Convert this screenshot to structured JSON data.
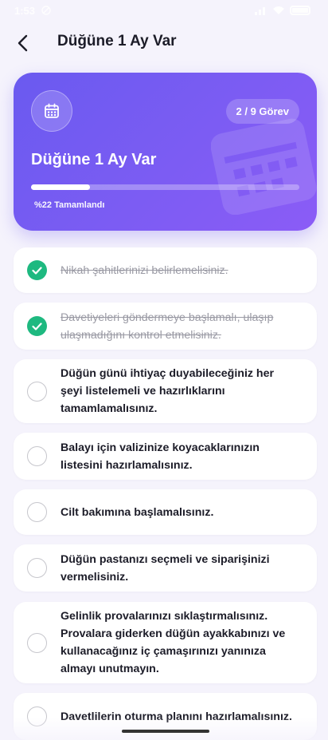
{
  "status_bar": {
    "time": "1:53"
  },
  "header": {
    "title": "Düğüne 1 Ay Var"
  },
  "hero": {
    "title": "Düğüne 1 Ay Var",
    "task_count": "2 / 9 Görev",
    "completed_text": "%22 Tamamlandı",
    "progress": 0.22,
    "gradient_start": "#6a5af0",
    "gradient_end": "#8b5cf6"
  },
  "accent_colors": {
    "done_check": "#1eb980",
    "todo_ring": "#c6c6cc"
  },
  "tasks": [
    {
      "text": "Nikah şahitlerinizi belirlemelisiniz.",
      "done": true
    },
    {
      "text": "Davetiyeleri göndermeye başlamalı, ulaşıp ulaşmadığını kontrol etmelisiniz.",
      "done": true
    },
    {
      "text": "Düğün günü ihtiyaç duyabileceğiniz her şeyi listelemeli ve hazırlıklarını tamamlamalısınız.",
      "done": false
    },
    {
      "text": "Balayı için valizinize koyacaklarınızın listesini hazırlamalısınız.",
      "done": false
    },
    {
      "text": "Cilt bakımına başlamalısınız.",
      "done": false
    },
    {
      "text": "Düğün pastanızı seçmeli ve siparişinizi vermelisiniz.",
      "done": false
    },
    {
      "text": "Gelinlik provalarınızı sıklaştırmalısınız. Provalara giderken düğün ayakkabınızı ve kullanacağınız iç çamaşırınızı yanınıza almayı unutmayın.",
      "done": false
    },
    {
      "text": "Davetlilerin oturma planını hazırlamalısınız.",
      "done": false
    }
  ]
}
